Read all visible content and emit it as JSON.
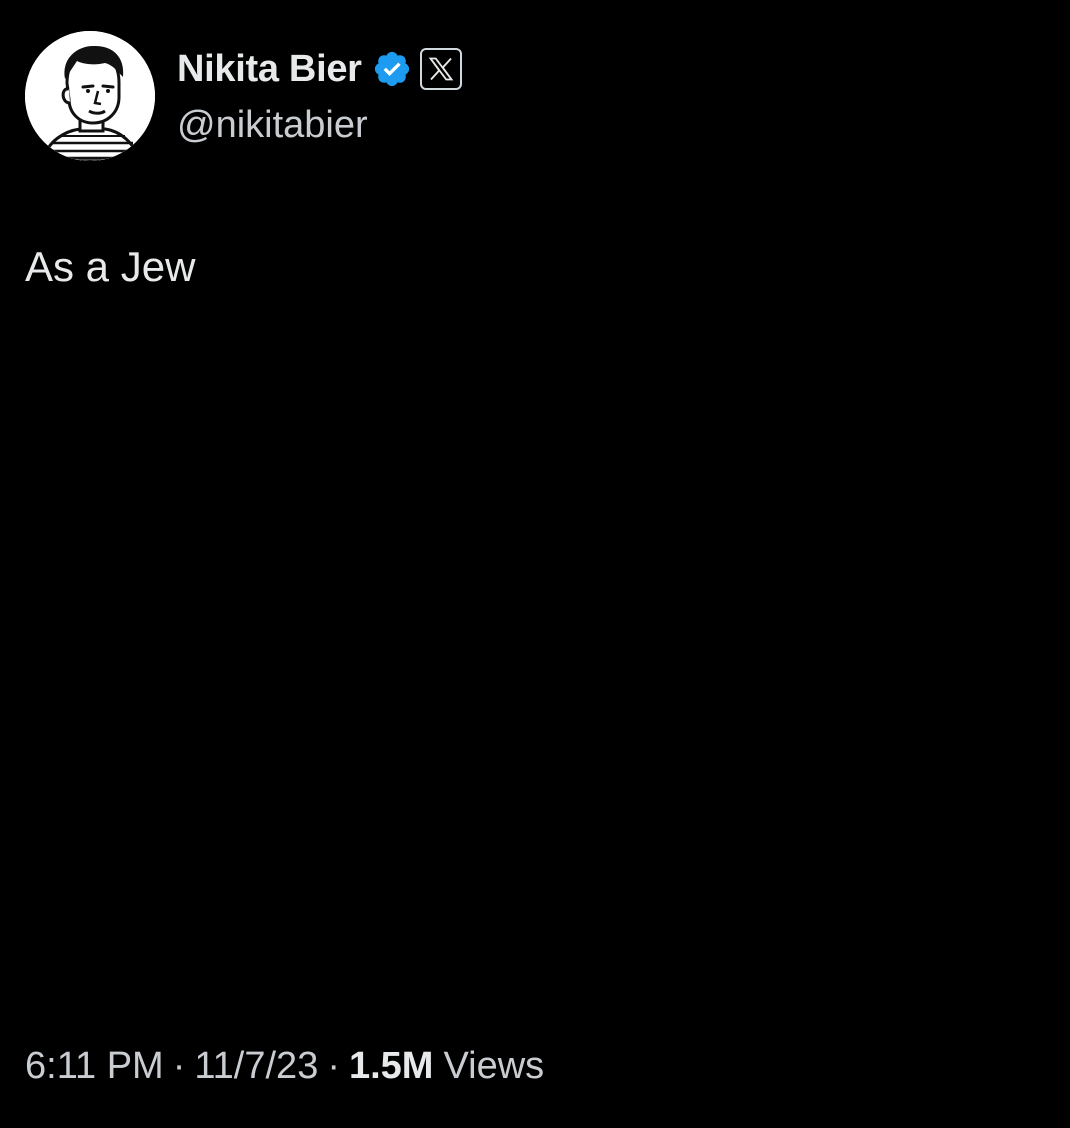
{
  "tweet": {
    "author": {
      "display_name": "Nikita Bier",
      "handle": "@nikitabier",
      "avatar_icon": "sketch-portrait-avatar",
      "verified_icon": "verified-badge-icon",
      "affiliate_icon": "x-logo-icon"
    },
    "text": "As a Jew",
    "meta": {
      "time": "6:11 PM",
      "separator": "·",
      "date": "11/7/23",
      "views_count": "1.5M",
      "views_label": "Views"
    }
  },
  "colors": {
    "background": "#000000",
    "primary_text": "#e7e9ea",
    "secondary_text": "#c9cdd1",
    "verified_blue": "#1d9bf0"
  }
}
